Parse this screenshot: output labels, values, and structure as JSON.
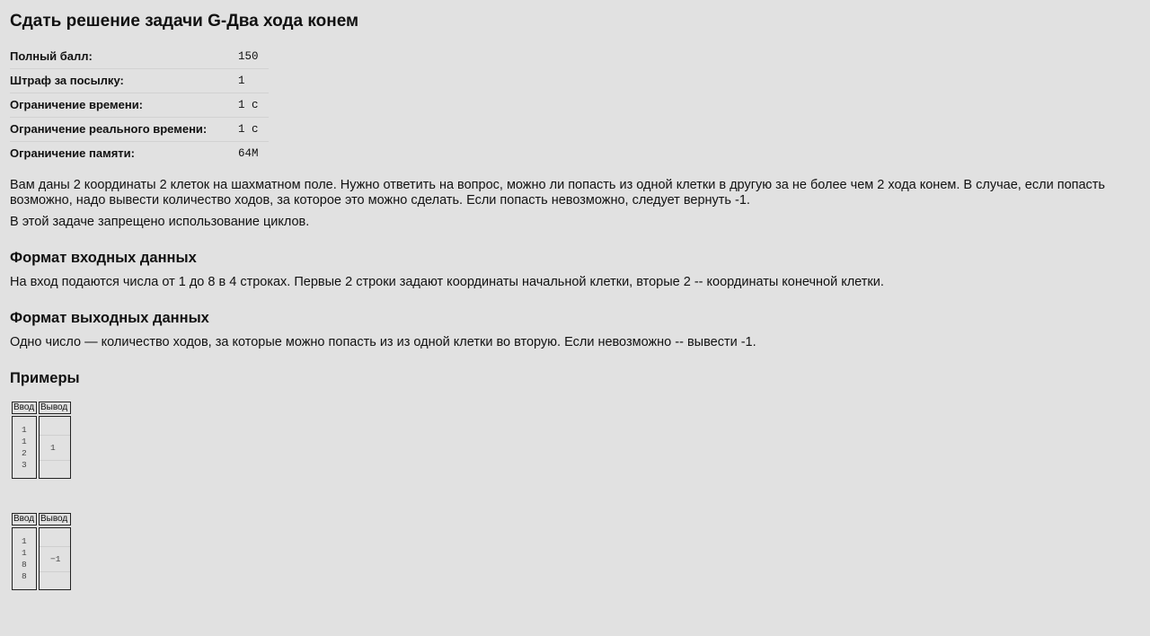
{
  "title": "Сдать решение задачи G-Два хода конем",
  "limits": [
    {
      "label": "Полный балл:",
      "value": "150"
    },
    {
      "label": "Штраф за посылку:",
      "value": "1"
    },
    {
      "label": "Ограничение времени:",
      "value": "1 с"
    },
    {
      "label": "Ограничение реального времени:",
      "value": "1 с"
    },
    {
      "label": "Ограничение памяти:",
      "value": "64M"
    }
  ],
  "statement": {
    "p1": "Вам даны 2 координаты 2 клеток на шахматном поле. Нужно ответить на вопрос, можно ли попасть из одной клетки в другую за не более чем 2 хода конем. В случае, если попасть возможно, надо вывести количество ходов, за которое это можно сделать. Если попасть невозможно, следует вернуть -1.",
    "p2": "В этой задаче запрещено использование циклов."
  },
  "input_format": {
    "heading": "Формат входных данных",
    "text": "На вход подаются числа от 1 до 8 в 4 строках. Первые 2 строки задают координаты начальной клетки, вторые 2 -- координаты конечной клетки."
  },
  "output_format": {
    "heading": "Формат выходных данных",
    "text": "Одно число — количество ходов, за которые можно попасть из из одной клетки во вторую. Если невозможно -- вывести -1."
  },
  "examples": {
    "heading": "Примеры",
    "input_label": "Ввод",
    "output_label": "Вывод",
    "items": [
      {
        "input": [
          "1",
          "1",
          "2",
          "3"
        ],
        "output": "1"
      },
      {
        "input": [
          "1",
          "1",
          "8",
          "8"
        ],
        "output": "−1"
      }
    ]
  }
}
